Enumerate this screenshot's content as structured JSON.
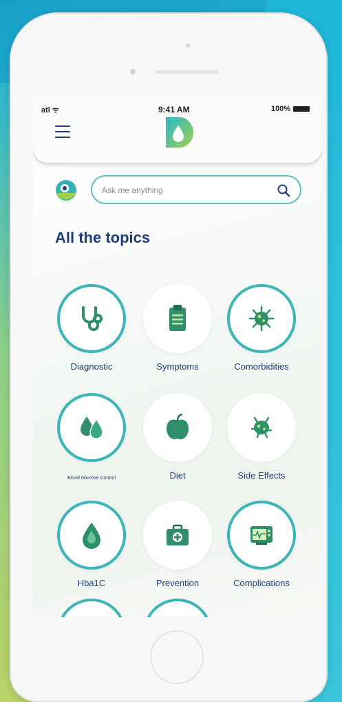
{
  "status_bar": {
    "signal": "atl ᯤ",
    "time": "9:41 AM",
    "battery": "100%"
  },
  "search": {
    "placeholder": "Ask me anything"
  },
  "section_title": "All the topics",
  "topics": [
    {
      "label": "Diagnostic",
      "icon": "stethoscope-icon",
      "ringed": true
    },
    {
      "label": "Symptoms",
      "icon": "clipboard-icon",
      "ringed": false
    },
    {
      "label": "Comorbidities",
      "icon": "virus-icon",
      "ringed": true
    },
    {
      "label": "Blood Glucose Control",
      "icon": "blood-drops-icon",
      "ringed": true
    },
    {
      "label": "Diet",
      "icon": "apple-icon",
      "ringed": false
    },
    {
      "label": "Side Effects",
      "icon": "bacteria-icon",
      "ringed": false
    },
    {
      "label": "Hba1C",
      "icon": "drop-icon",
      "ringed": true
    },
    {
      "label": "Prevention",
      "icon": "first-aid-kit-icon",
      "ringed": false
    },
    {
      "label": "Complications",
      "icon": "monitor-icon",
      "ringed": true
    }
  ],
  "colors": {
    "brand_navy": "#1f3e7a",
    "brand_teal": "#3bb5b8",
    "icon_green": "#2f8f6a"
  }
}
